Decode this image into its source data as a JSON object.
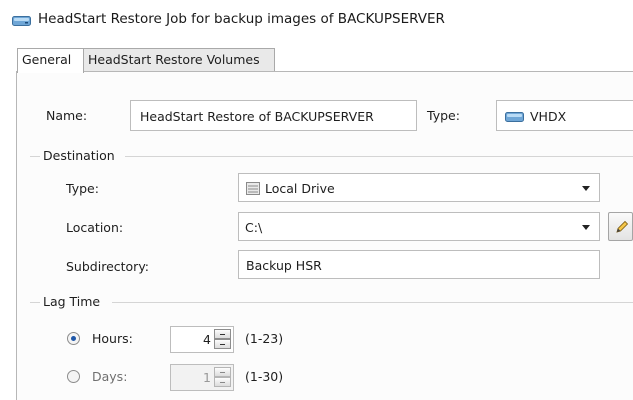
{
  "window": {
    "title": "HeadStart Restore Job for backup images of BACKUPSERVER",
    "icon": "drive-icon"
  },
  "tabs": [
    {
      "label": "General",
      "active": true
    },
    {
      "label": "HeadStart Restore Volumes",
      "active": false
    }
  ],
  "general": {
    "name_label": "Name:",
    "name_value": "HeadStart Restore of BACKUPSERVER",
    "type_label": "Type:",
    "type_value": "VHDX"
  },
  "destination": {
    "group_label": "Destination",
    "type_label": "Type:",
    "type_value": "Local Drive",
    "location_label": "Location:",
    "location_value": "C:\\",
    "subdirectory_label": "Subdirectory:",
    "subdirectory_value": "Backup HSR"
  },
  "lag_time": {
    "group_label": "Lag Time",
    "hours_label": "Hours:",
    "hours_value": "4",
    "hours_range": "(1-23)",
    "hours_selected": true,
    "days_label": "Days:",
    "days_value": "1",
    "days_range": "(1-30)",
    "days_selected": false
  },
  "colors": {
    "accent": "#1f57a8",
    "border": "#bdbdbd"
  }
}
